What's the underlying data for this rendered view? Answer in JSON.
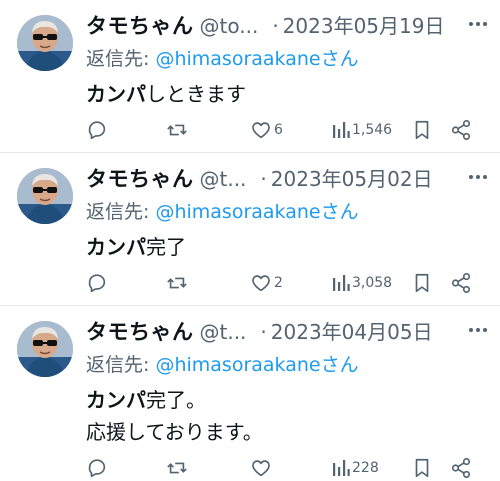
{
  "tweets": [
    {
      "name": "タモちゃん",
      "handle": "@to...",
      "separator": "·",
      "date": "2023年05月19日",
      "reply_prefix": "返信先: ",
      "reply_to": "@himasoraakane",
      "reply_suffix": "さん",
      "body_bold": "カンパ",
      "body_rest": "しときます",
      "body_line2": "",
      "likes": "6",
      "views": "1,546"
    },
    {
      "name": "タモちゃん",
      "handle": "@t...",
      "separator": "·",
      "date": "2023年05月02日",
      "reply_prefix": "返信先: ",
      "reply_to": "@himasoraakane",
      "reply_suffix": "さん",
      "body_bold": "カンパ",
      "body_rest": "完了",
      "body_line2": "",
      "likes": "2",
      "views": "3,058"
    },
    {
      "name": "タモちゃん",
      "handle": "@t...",
      "separator": "·",
      "date": "2023年04月05日",
      "reply_prefix": "返信先: ",
      "reply_to": "@himasoraakane",
      "reply_suffix": "さん",
      "body_bold": "カンパ",
      "body_rest": "完了。",
      "body_line2": "応援しております。",
      "likes": "",
      "views": "228"
    }
  ],
  "icons": [
    "more-icon",
    "reply-icon",
    "retweet-icon",
    "like-icon",
    "views-icon",
    "bookmark-icon",
    "share-icon"
  ],
  "colors": {
    "link": "#1d9bf0",
    "muted": "#536471",
    "text": "#0f1419",
    "divider": "#e7e9eb"
  }
}
